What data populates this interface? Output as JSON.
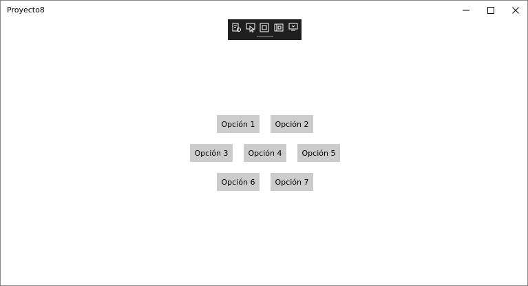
{
  "window": {
    "title": "Proyecto8"
  },
  "title_controls": [
    {
      "name": "minimize",
      "icon": "minimize-icon"
    },
    {
      "name": "maximize",
      "icon": "maximize-icon"
    },
    {
      "name": "close",
      "icon": "close-icon"
    }
  ],
  "debug_toolbar": {
    "background": "#1f1f1f",
    "icon_color": "#ffffff",
    "buttons": [
      {
        "icon": "live-visual-tree-icon"
      },
      {
        "icon": "select-element-icon"
      },
      {
        "icon": "display-layout-adorners-icon"
      },
      {
        "icon": "track-focused-element-icon"
      },
      {
        "icon": "hot-reload-icon"
      }
    ]
  },
  "options": {
    "button_color": "#cccccc",
    "labels": [
      "Opción 1",
      "Opción 2",
      "Opción 3",
      "Opción 4",
      "Opción 5",
      "Opción 6",
      "Opción 7"
    ]
  }
}
